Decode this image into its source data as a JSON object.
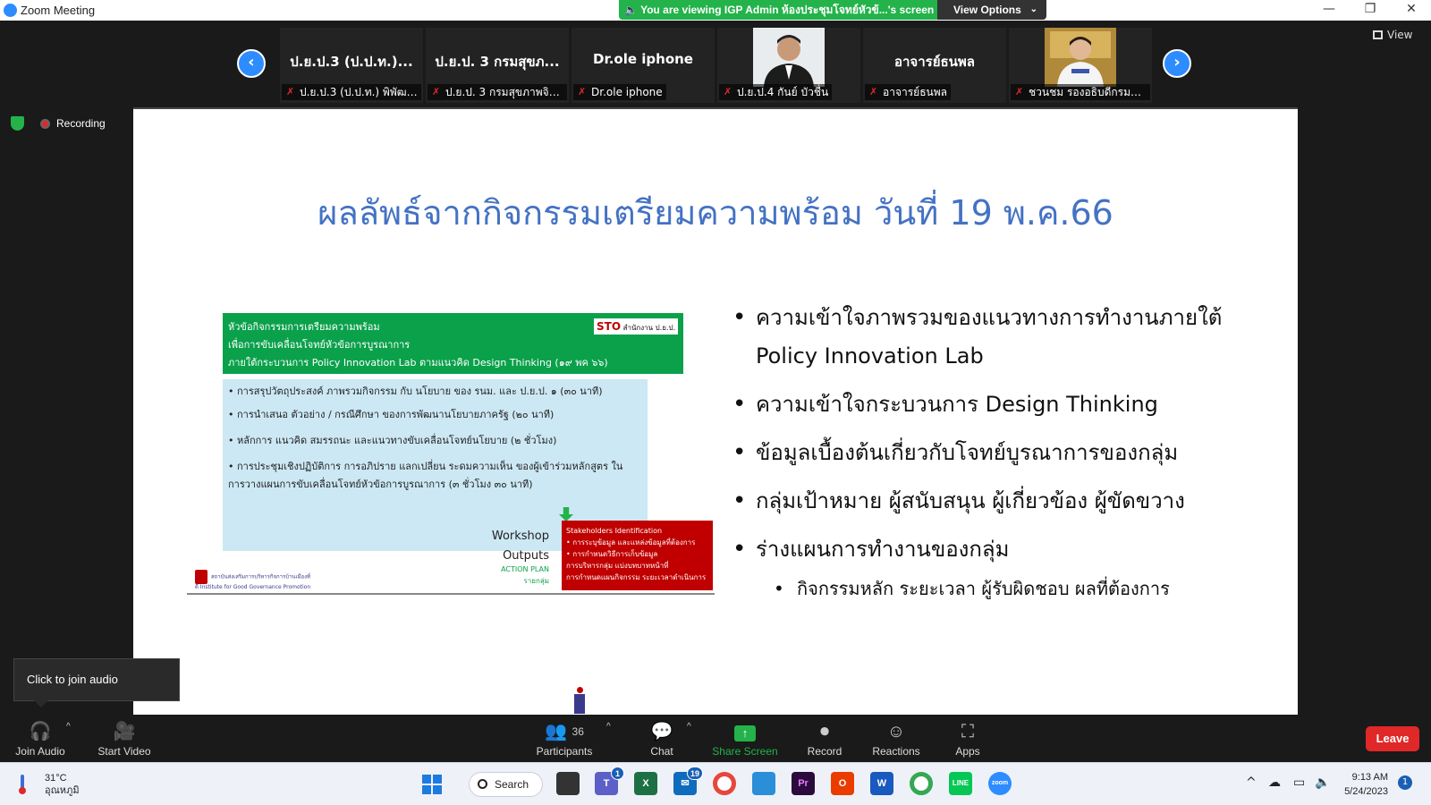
{
  "window": {
    "title": "Zoom Meeting",
    "controls": [
      "—",
      "❐",
      "✕"
    ]
  },
  "share_banner": {
    "text": "You are viewing IGP Admin ห้องประชุมโจทย์หัวข้...'s screen",
    "view_options_label": "View Options"
  },
  "gallery": {
    "tiles": [
      {
        "name": "ป.ย.ป.3 (ป.ป.ท.)...",
        "label": "ป.ย.ป.3 (ป.ป.ท.) พิพัฒน์ ...",
        "has_photo": false
      },
      {
        "name": "ป.ย.ป. 3 กรมสุขภ...",
        "label": "ป.ย.ป. 3 กรมสุขภาพจิต ...",
        "has_photo": false
      },
      {
        "name": "Dr.ole iphone",
        "label": "Dr.ole iphone",
        "has_photo": false
      },
      {
        "name": "",
        "label": "ป.ย.ป.4 กันย์ บัวชื่น",
        "has_photo": true
      },
      {
        "name": "อาจารย์ธนพล",
        "label": "อาจารย์ธนพล",
        "has_photo": false
      },
      {
        "name": "",
        "label": "ชวนชม รองอธิบดีกรมกิจ...",
        "has_photo": true
      }
    ],
    "view_label": "View"
  },
  "recording": {
    "label": "Recording"
  },
  "slide": {
    "title": "ผลลัพธ์จากกิจกรรมเตรียมความพร้อม วันที่ 19 พ.ค.66",
    "image": {
      "green_lines": [
        "หัวข้อกิจกรรมการเตรียมความพร้อม",
        "เพื่อการขับเคลื่อนโจทย์หัวข้อการบูรณาการ",
        "ภายใต้กระบวนการ Policy Innovation Lab ตามแนวคิด Design Thinking (๑๙ พค ๖๖)"
      ],
      "sto_logo": "STO",
      "sto_text": "สำนักงาน ป.ย.ป.",
      "blue_items": [
        "• การสรุปวัตถุประสงค์ ภาพรวมกิจกรรม กับ นโยบาย ของ รนม. และ ป.ย.ป. ๑ (๓๐ นาที)",
        "• การนำเสนอ ตัวอย่าง / กรณีศึกษา ของการพัฒนานโยบายภาครัฐ (๒๐ นาที)",
        "• หลักการ แนวคิด สมรรถนะ และแนวทางขับเคลื่อนโจทย์นโยบาย (๒ ชั่วโมง)",
        "• การประชุมเชิงปฏิบัติการ การอภิปราย แลกเปลี่ยน ระดมความเห็น ของผู้เข้าร่วมหลักสูตร ในการวางแผนการขับเคลื่อนโจทย์หัวข้อการบูรณาการ (๓ ชั่วโมง ๓๐ นาที)"
      ],
      "workshop": "Workshop",
      "outputs": "Outputs",
      "action_plan": "ACTION PLAN",
      "group": "รายกลุ่ม",
      "red_title": "Stakeholders Identification",
      "red_items": [
        "• การระบุข้อมูล และแหล่งข้อมูลที่ต้องการ",
        "• การกำหนดวิธีการเก็บข้อมูล",
        "การบริหารกลุ่ม แบ่งบทบาทหน้าที่",
        "การกำหนดแผนกิจกรรม ระยะเวลาดำเนินการ"
      ],
      "igp_text": "สถาบันส่งเสริมการบริหารกิจการบ้านเมืองที่ดี Institute for Good Governance Promotion"
    },
    "bullets": [
      "ความเข้าใจภาพรวมของแนวทางการทำงานภายใต้ Policy Innovation Lab",
      "ความเข้าใจกระบวนการ Design Thinking",
      "ข้อมูลเบื้องต้นเกี่ยวกับโจทย์บูรณาการของกลุ่ม",
      "กลุ่มเป้าหมาย ผู้สนับสนุน ผู้เกี่ยวข้อง ผู้ขัดขวาง",
      "ร่างแผนการทำงานของกลุ่ม"
    ],
    "sub_bullet": "กิจกรรมหลัก ระยะเวลา ผู้รับผิดชอบ ผลที่ต้องการ"
  },
  "audio_tooltip": "Click to join audio",
  "toolbar": {
    "join_audio": "Join Audio",
    "start_video": "Start Video",
    "participants": "Participants",
    "participants_count": "36",
    "chat": "Chat",
    "share_screen": "Share Screen",
    "record": "Record",
    "reactions": "Reactions",
    "apps": "Apps",
    "leave": "Leave"
  },
  "taskbar": {
    "weather_temp": "31°C",
    "weather_desc": "อุณหภูมิ",
    "search": "Search",
    "teams_badge": "1",
    "mail_badge": "19",
    "time": "9:13 AM",
    "date": "5/24/2023",
    "notifications": "1"
  },
  "colors": {
    "zoom_blue": "#2d8cff",
    "share_green": "#23b34a",
    "leave_red": "#e02828",
    "slide_title": "#4472c4"
  }
}
